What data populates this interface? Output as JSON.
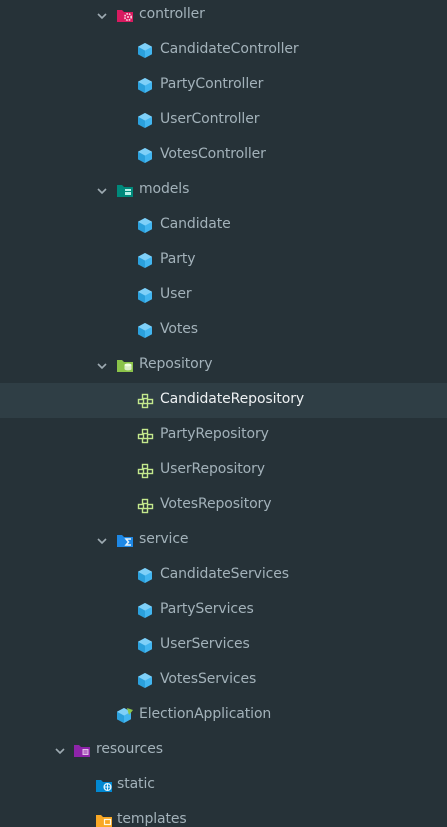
{
  "project_tree": {
    "controller": {
      "folder_label": "controller",
      "icon": "controller-package-icon",
      "items": [
        {
          "label": "CandidateController",
          "icon": "class-icon"
        },
        {
          "label": "PartyController",
          "icon": "class-icon"
        },
        {
          "label": "UserController",
          "icon": "class-icon"
        },
        {
          "label": "VotesController",
          "icon": "class-icon"
        }
      ]
    },
    "models": {
      "folder_label": "models",
      "icon": "models-package-icon",
      "items": [
        {
          "label": "Candidate",
          "icon": "class-icon"
        },
        {
          "label": "Party",
          "icon": "class-icon"
        },
        {
          "label": "User",
          "icon": "class-icon"
        },
        {
          "label": "Votes",
          "icon": "class-icon"
        }
      ]
    },
    "repository": {
      "folder_label": "Repository",
      "icon": "repository-package-icon",
      "selected_item": "CandidateRepository",
      "items": [
        {
          "label": "CandidateRepository",
          "icon": "interface-icon"
        },
        {
          "label": "PartyRepository",
          "icon": "interface-icon"
        },
        {
          "label": "UserRepository",
          "icon": "interface-icon"
        },
        {
          "label": "VotesRepository",
          "icon": "interface-icon"
        }
      ]
    },
    "service": {
      "folder_label": "service",
      "icon": "service-package-icon",
      "items": [
        {
          "label": "CandidateServices",
          "icon": "class-icon"
        },
        {
          "label": "PartyServices",
          "icon": "class-icon"
        },
        {
          "label": "UserServices",
          "icon": "class-icon"
        },
        {
          "label": "VotesServices",
          "icon": "class-icon"
        }
      ]
    },
    "election_application": {
      "label": "ElectionApplication",
      "icon": "spring-application-icon"
    },
    "resources": {
      "folder_label": "resources",
      "icon": "resources-folder-icon",
      "items": [
        {
          "label": "static",
          "icon": "static-folder-icon"
        },
        {
          "label": "templates",
          "icon": "templates-folder-icon"
        }
      ]
    }
  },
  "colors": {
    "background": "#263238",
    "selected_row": "#2f3e45",
    "text": "#a3b2ba",
    "class_icon": "#42b5f0",
    "interface_icon": "#c3e88d",
    "controller_folder": "#d81b60",
    "models_folder": "#00897b",
    "repository_folder": "#8bc34a",
    "service_folder": "#1e88e5",
    "resources_folder": "#8e24aa",
    "static_folder": "#0288d1",
    "templates_folder": "#f9a825"
  }
}
